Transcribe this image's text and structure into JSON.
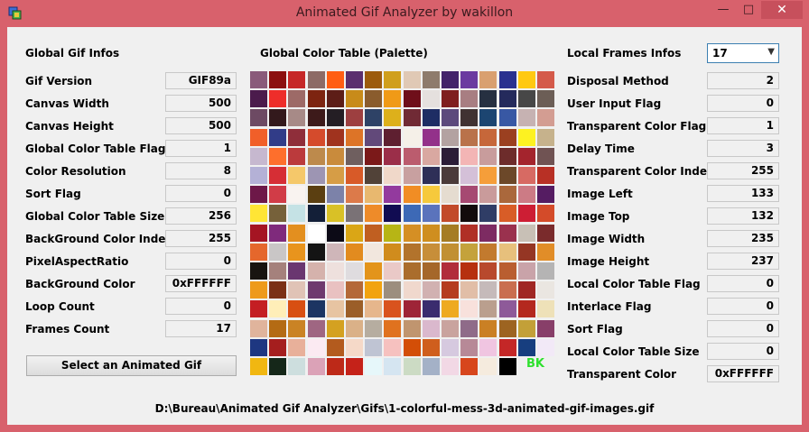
{
  "window": {
    "title": "Animated Gif Analyzer by wakillon"
  },
  "global": {
    "header": "Global Gif Infos",
    "rows": [
      {
        "label": "Gif Version",
        "value": "GIF89a"
      },
      {
        "label": "Canvas Width",
        "value": "500"
      },
      {
        "label": "Canvas Height",
        "value": "500"
      },
      {
        "label": "Global Color Table Flag",
        "value": "1"
      },
      {
        "label": "Color Resolution",
        "value": "8"
      },
      {
        "label": "Sort Flag",
        "value": "0"
      },
      {
        "label": "Global Color Table Size",
        "value": "256"
      },
      {
        "label": "BackGround Color Index",
        "value": "255"
      },
      {
        "label": "PixelAspectRatio",
        "value": "0"
      },
      {
        "label": "BackGround Color",
        "value": "0xFFFFFF"
      },
      {
        "label": "Loop Count",
        "value": "0"
      },
      {
        "label": "Frames Count",
        "value": "17"
      }
    ],
    "select_button": "Select an Animated Gif"
  },
  "palette": {
    "header": "Global Color Table (Palette)",
    "bk_label": "BK",
    "colors": [
      [
        "#8a5a7a",
        "#8c0f0f",
        "#c62828",
        "#8d6b66",
        "#ff5e13",
        "#5b2f6e",
        "#9c5b0c",
        "#d09f1d",
        "#e0c9b5",
        "#8e7b6c",
        "#43236a",
        "#6b3aa0",
        "#d9a070",
        "#2a318f",
        "#ffc911",
        "#d45a4a"
      ],
      [
        "#4b1b4c",
        "#ee2d2a",
        "#9d6a67",
        "#7d2410",
        "#5d1d17",
        "#c88b1a",
        "#8a5c2d",
        "#f09a17",
        "#6f0f1a",
        "#e5e0de",
        "#7f1f1f",
        "#a87e82",
        "#263041",
        "#242a5c",
        "#474747",
        "#6c5e56"
      ],
      [
        "#6d4a63",
        "#33191c",
        "#a78a87",
        "#3d1a1a",
        "#241e24",
        "#9d3f40",
        "#2e4266",
        "#ddb01b",
        "#702a35",
        "#1e2d64",
        "#5c4a7c",
        "#403232",
        "#1c4571",
        "#3858a4",
        "#c6b2b2",
        "#d39d92"
      ],
      [
        "#f15f29",
        "#313c88",
        "#8f2e3a",
        "#d54b2c",
        "#a0331e",
        "#dd7427",
        "#62497a",
        "#5e1f30",
        "#f5f0e8",
        "#93318a",
        "#b3a2a1",
        "#b9724a",
        "#c6673a",
        "#9b4020",
        "#fdf221",
        "#c6b28c"
      ],
      [
        "#c6b8cf",
        "#fe6f2c",
        "#bb3a3c",
        "#bd8a4c",
        "#c98b3c",
        "#6f5f5f",
        "#7b1919",
        "#9b2e49",
        "#bb5c6e",
        "#d9a8a1",
        "#2b1d37",
        "#f3b5b5",
        "#c89c9c",
        "#6d2c2b",
        "#a4242d",
        "#705353"
      ],
      [
        "#b4b1d6",
        "#d62e35",
        "#f5c86a",
        "#9d95b3",
        "#d69d46",
        "#d85a28",
        "#514238",
        "#f0d8c9",
        "#c8a0a0",
        "#2e2f57",
        "#4b3b3a",
        "#d4c0d8",
        "#f59e3a",
        "#6c4829",
        "#d76a63",
        "#b83025"
      ],
      [
        "#6d1848",
        "#d13c47",
        "#f9f3f0",
        "#5b3f11",
        "#7c82a9",
        "#dc7a4a",
        "#e8b86f",
        "#933a9e",
        "#f18d24",
        "#f6c93c",
        "#e5dcd0",
        "#a64972",
        "#c99b9b",
        "#aa683c",
        "#cc7b85",
        "#551c62"
      ],
      [
        "#ffe535",
        "#76613a",
        "#c5e2e5",
        "#131f38",
        "#d9c126",
        "#7a7276",
        "#ee8b29",
        "#110c52",
        "#3d69b6",
        "#5a73bc",
        "#c24a2a",
        "#120b0c",
        "#2f3d66",
        "#d85d27",
        "#cd1e34",
        "#d44b29"
      ],
      [
        "#a51523",
        "#7f2a7c",
        "#e38f1f",
        "#ffffff",
        "#0c0a16",
        "#daa616",
        "#c05f21",
        "#b7b515",
        "#d58f24",
        "#cf8e1f",
        "#a57c24",
        "#b03026",
        "#7d2b62",
        "#9a314e",
        "#c8c0b6",
        "#7a2b2c"
      ],
      [
        "#e5672c",
        "#c9c6c6",
        "#e8941d",
        "#141414",
        "#cfb6b9",
        "#e28b1f",
        "#f2e7de",
        "#d08c1d",
        "#b2732c",
        "#c78e39",
        "#c19033",
        "#c4a23b",
        "#c27a2e",
        "#e7c07c",
        "#953624",
        "#e18d28"
      ],
      [
        "#181410",
        "#a5817c",
        "#6a3670",
        "#d5b2ac",
        "#eee0dd",
        "#dfdcdf",
        "#e3941b",
        "#eac9c7",
        "#aa6d2c",
        "#a5672a",
        "#b12c3b",
        "#b6300f",
        "#b8492d",
        "#b95e30",
        "#c9a3a9",
        "#b5b4b4"
      ],
      [
        "#ee9a1a",
        "#7b3016",
        "#e0c3b6",
        "#6e3a6e",
        "#e9c1c1",
        "#b46838",
        "#f2a30f",
        "#9c8e7e",
        "#f0d8cd",
        "#d1b1b1",
        "#b53c1f",
        "#e1bea7",
        "#c5baba",
        "#c96e4f",
        "#a02724",
        "#eae6e1"
      ],
      [
        "#c41e23",
        "#ffeeb8",
        "#d84f12",
        "#1c3562",
        "#e7c4a2",
        "#9b5e28",
        "#e6b68c",
        "#d9531e",
        "#9e2437",
        "#3a2c6e",
        "#eeaa20",
        "#f8e1dc",
        "#ba9f8e",
        "#8e5a99",
        "#b4281e",
        "#eee1b8"
      ],
      [
        "#e0b49c",
        "#b46b14",
        "#ca8324",
        "#9f6682",
        "#d4a121",
        "#dab188",
        "#b6ada0",
        "#e0721f",
        "#c0956f",
        "#dab8cd",
        "#c9a39e",
        "#8f6b89",
        "#ca8024",
        "#9d6421",
        "#c3a038",
        "#883f69"
      ],
      [
        "#1e3781",
        "#a51e1e",
        "#e8b09a",
        "#fbeaf2",
        "#b35b1e",
        "#f5d9c8",
        "#bfc4d3",
        "#f6c1bf",
        "#d34e07",
        "#cf5e1d",
        "#d6c9df",
        "#b78997",
        "#f0c5e1",
        "#c42727",
        "#173e7f",
        "#f2e9f7"
      ],
      [
        "#f1b711",
        "#152719",
        "#cddede",
        "#dba2b7",
        "#bd2918",
        "#c52219",
        "#e6f7fa",
        "#d5e5f1",
        "#ccdbc4",
        "#a4b1c7",
        "#f2d8e5",
        "#d7461d",
        "#f5ebde",
        "#000000",
        "#f0f0f0",
        "#f0f0f0"
      ]
    ]
  },
  "local": {
    "header": "Local Frames Infos",
    "frame_select_value": "17",
    "rows": [
      {
        "label": "Disposal Method",
        "value": "2"
      },
      {
        "label": "User Input Flag",
        "value": "0"
      },
      {
        "label": "Transparent Color Flag",
        "value": "1"
      },
      {
        "label": "Delay Time",
        "value": "3"
      },
      {
        "label": "Transparent Color Index",
        "value": "255"
      },
      {
        "label": "Image Left",
        "value": "133"
      },
      {
        "label": "Image Top",
        "value": "132"
      },
      {
        "label": "Image  Width",
        "value": "235"
      },
      {
        "label": "Image Height",
        "value": "237"
      },
      {
        "label": "Local Color Table Flag",
        "value": "0"
      },
      {
        "label": "Interlace Flag",
        "value": "0"
      },
      {
        "label": "Sort Flag",
        "value": "0"
      },
      {
        "label": "Local Color Table Size",
        "value": "0"
      },
      {
        "label": "Transparent Color",
        "value": "0xFFFFFF"
      }
    ]
  },
  "status": {
    "path": "D:\\Bureau\\Animated Gif Analyzer\\Gifs\\1-colorful-mess-3d-animated-gif-images.gif"
  }
}
